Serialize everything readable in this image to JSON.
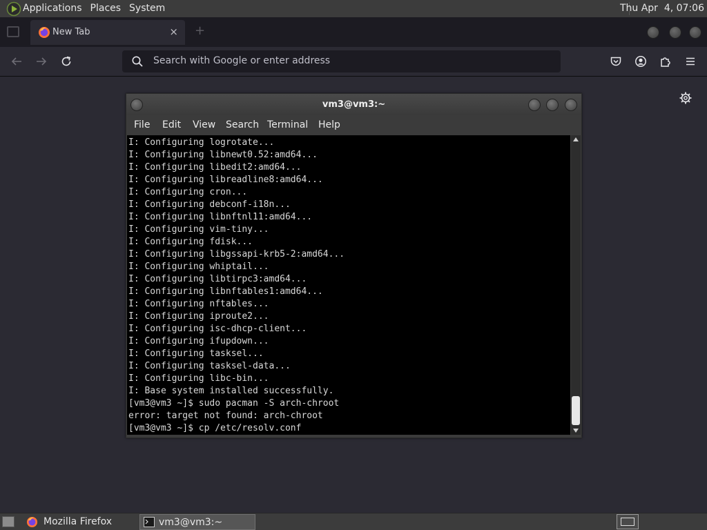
{
  "top_panel": {
    "menus": [
      "Applications",
      "Places",
      "System"
    ],
    "clock": "Thu Apr  4, 07:06"
  },
  "browser": {
    "tab": {
      "label": "New Tab",
      "close_glyph": "×",
      "icon": "firefox-icon"
    },
    "new_tab_glyph": "+",
    "url_bar": {
      "placeholder": "Search with Google or enter address",
      "icon": "search-icon"
    },
    "nav_icons": [
      "back-arrow-icon",
      "forward-arrow-icon",
      "reload-icon"
    ],
    "toolbar_icons": [
      "pocket-icon",
      "account-icon",
      "extensions-icon",
      "menu-icon"
    ],
    "content_icon": "gear-icon",
    "colors": {
      "chrome_bg": "#1c1b22",
      "toolbar_bg": "#2b2a33",
      "urlbar_bg": "#1c1b22"
    }
  },
  "terminal": {
    "title": "vm3@vm3:~",
    "menu": [
      "File",
      "Edit",
      "View",
      "Search",
      "Terminal",
      "Help"
    ],
    "lines": [
      "I: Configuring logrotate...",
      "I: Configuring libnewt0.52:amd64...",
      "I: Configuring libedit2:amd64...",
      "I: Configuring libreadline8:amd64...",
      "I: Configuring cron...",
      "I: Configuring debconf-i18n...",
      "I: Configuring libnftnl11:amd64...",
      "I: Configuring vim-tiny...",
      "I: Configuring fdisk...",
      "I: Configuring libgssapi-krb5-2:amd64...",
      "I: Configuring whiptail...",
      "I: Configuring libtirpc3:amd64...",
      "I: Configuring libnftables1:amd64...",
      "I: Configuring nftables...",
      "I: Configuring iproute2...",
      "I: Configuring isc-dhcp-client...",
      "I: Configuring ifupdown...",
      "I: Configuring tasksel...",
      "I: Configuring tasksel-data...",
      "I: Configuring libc-bin...",
      "I: Base system installed successfully.",
      "[vm3@vm3 ~]$ sudo pacman -S arch-chroot",
      "error: target not found: arch-chroot",
      "[vm3@vm3 ~]$ cp /etc/resolv.conf"
    ],
    "colors": {
      "background": "#000000",
      "foreground": "#d8d8d8"
    }
  },
  "taskbar": {
    "tasks": [
      {
        "label": "Mozilla Firefox",
        "icon": "firefox-icon",
        "active": false
      },
      {
        "label": "vm3@vm3:~",
        "icon": "terminal-icon",
        "active": true
      }
    ]
  }
}
